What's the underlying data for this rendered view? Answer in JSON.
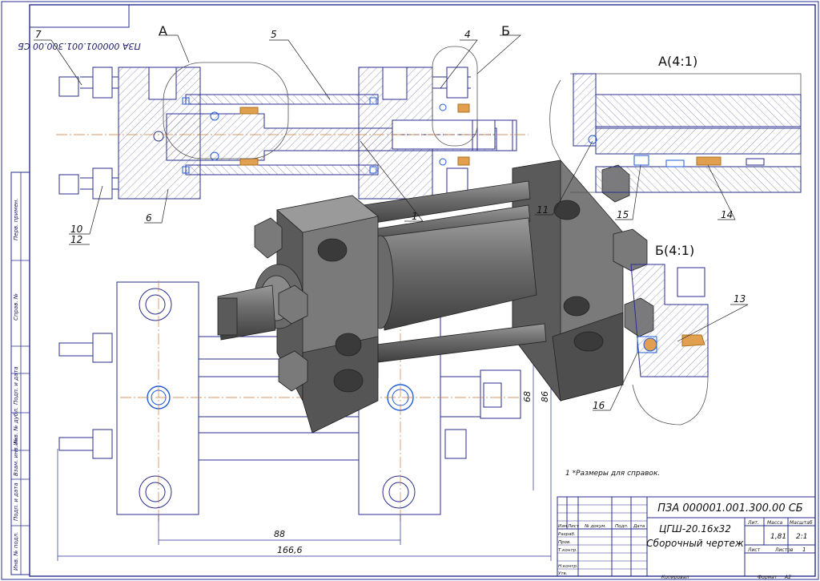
{
  "drawing": {
    "rotated_code": "ПЗА 000001.001.300.00 СБ",
    "view_a_title": "А(4:1)",
    "view_b_title": "Б(4:1)",
    "section_marks": {
      "a": "А",
      "b": "Б"
    },
    "callouts": [
      "7",
      "5",
      "4",
      "10",
      "12",
      "6",
      "1",
      "11",
      "15",
      "14",
      "13",
      "16"
    ],
    "dimensions": {
      "d88": "88",
      "d166": "166,6",
      "d68": "68",
      "d86": "86"
    },
    "note": "1 *Размеры для справок."
  },
  "title_block": {
    "doc_code": "ПЗА 000001.001.300.00 СБ",
    "name_line1": "ЦГШ-20.16х32",
    "name_line2": "Сборочный чертеж",
    "header_labels": [
      "Изм",
      "Лист",
      "№ докум.",
      "Подп.",
      "Дата"
    ],
    "role_labels": [
      "Разраб.",
      "Пров.",
      "Т.контр.",
      "Н.контр.",
      "Утв."
    ],
    "lit_label": "Лит.",
    "mass_label": "Масса",
    "scale_label": "Масштаб",
    "mass_value": "1,81",
    "scale_value": "2:1",
    "sheet_label": "Лист",
    "sheets_label": "Листов",
    "sheets_value": "1",
    "copied_label": "Копировал",
    "format_label": "Формат",
    "format_value": "А2"
  },
  "side_stamp": [
    "Перв. примен.",
    "Справ. №",
    "Подп. и дата",
    "Инв. № дубл.",
    "Взам. инв. №",
    "Подп. и дата",
    "Инв. № подл."
  ],
  "colors": {
    "line": "#2a2d8f",
    "blue": "#1e5bd6",
    "hatch": "#6a6a9a",
    "solid": "#6b6b6b",
    "solid_dark": "#4a4a4a",
    "orange": "#e0a050"
  }
}
